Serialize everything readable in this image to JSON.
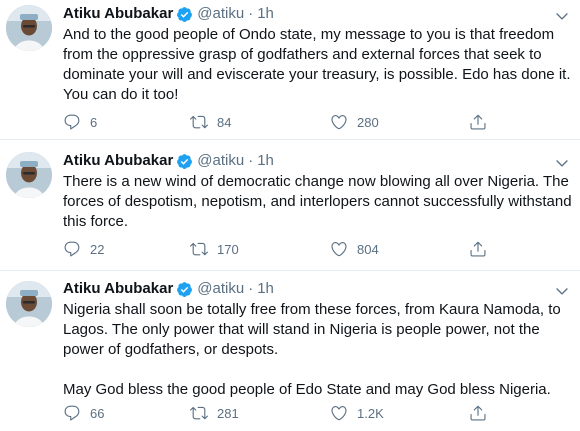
{
  "colors": {
    "verified": "#1da1f2",
    "secondary_text": "#5b7083",
    "primary_text": "#0f1419",
    "divider": "#e6ecf0"
  },
  "icons": {
    "verified": "verified-badge-icon",
    "caret": "chevron-down-icon",
    "reply": "reply-icon",
    "retweet": "retweet-icon",
    "like": "heart-icon",
    "share": "share-icon"
  },
  "tweets": [
    {
      "name": "Atiku Abubakar",
      "handle": "@atiku",
      "separator": "·",
      "time": "1h",
      "paragraphs": [
        "And to the good people of Ondo state, my message to you is that freedom from the oppressive grasp of godfathers and external forces that seek to dominate your will and eviscerate your treasury, is possible. Edo has done it. You can do it too!"
      ],
      "replies": "6",
      "retweets": "84",
      "likes": "280"
    },
    {
      "name": "Atiku Abubakar",
      "handle": "@atiku",
      "separator": "·",
      "time": "1h",
      "paragraphs": [
        "There is a new wind of democratic change now blowing all over Nigeria. The forces of despotism, nepotism, and interlopers cannot successfully withstand this force."
      ],
      "replies": "22",
      "retweets": "170",
      "likes": "804"
    },
    {
      "name": "Atiku Abubakar",
      "handle": "@atiku",
      "separator": "·",
      "time": "1h",
      "paragraphs": [
        "Nigeria shall soon be totally free from these forces, from Kaura Namoda, to Lagos. The only power that will stand in Nigeria is people power, not the power of godfathers, or despots.",
        "May God bless the good people of Edo State and may God bless Nigeria."
      ],
      "replies": "66",
      "retweets": "281",
      "likes": "1.2K"
    }
  ]
}
